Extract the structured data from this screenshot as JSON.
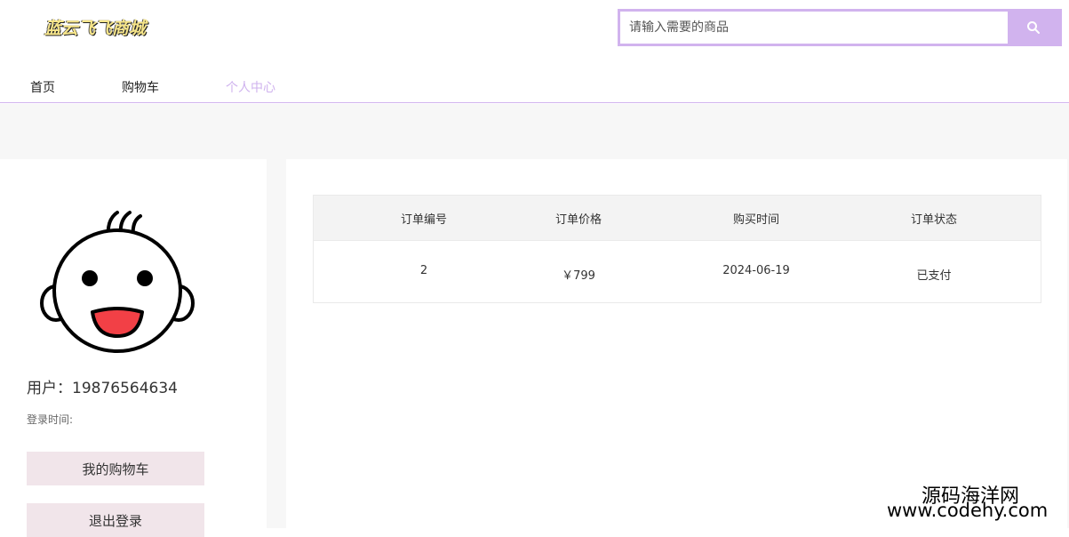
{
  "header": {
    "logo_text": "蓝云飞飞商城",
    "search": {
      "placeholder": "请输入需要的商品",
      "value": ""
    }
  },
  "nav": {
    "items": [
      {
        "label": "首页",
        "active": false
      },
      {
        "label": "购物车",
        "active": false
      },
      {
        "label": "个人中心",
        "active": true
      }
    ]
  },
  "sidebar": {
    "avatar_icon": "baby-face-icon",
    "user_label": "用户：",
    "user_value": "19876564634",
    "login_time_label": "登录时间:",
    "buttons": {
      "cart": "我的购物车",
      "logout": "退出登录"
    }
  },
  "orders": {
    "headers": [
      "订单编号",
      "订单价格",
      "购买时间",
      "订单状态"
    ],
    "rows": [
      {
        "id": "2",
        "price": "￥799",
        "time": "2024-06-19",
        "status": "已支付"
      }
    ]
  },
  "watermark": {
    "title": "源码海洋网",
    "url": "www.codehy.com"
  },
  "colors": {
    "accent": "#d1b3ee",
    "active_nav": "#cfb2ee",
    "side_button": "#f1e5ea",
    "page_bg": "#f7f7f7"
  }
}
